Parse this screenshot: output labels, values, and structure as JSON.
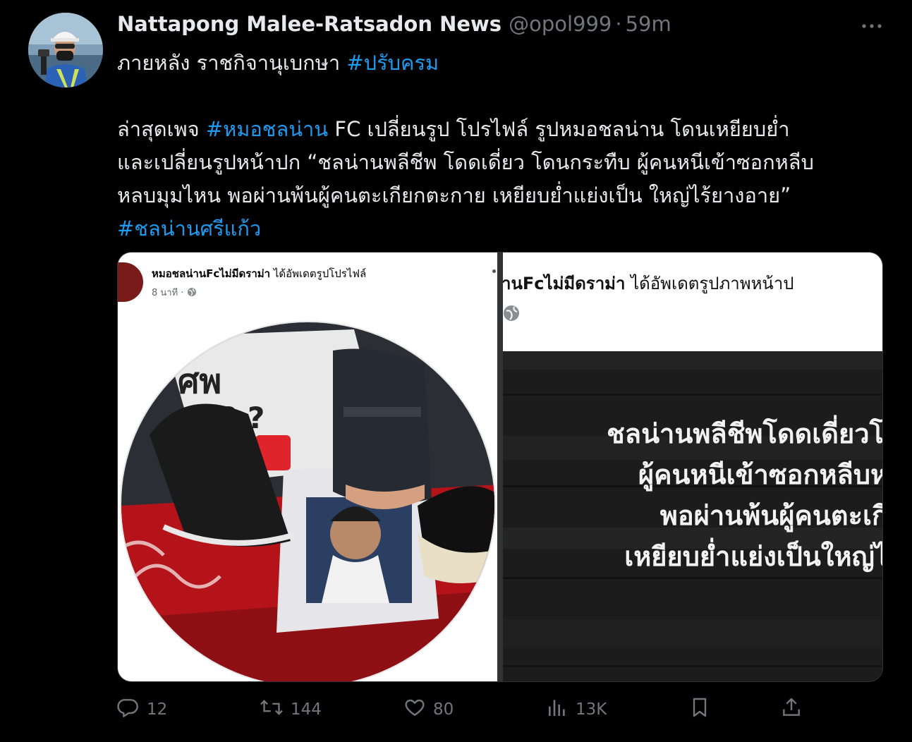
{
  "tweet": {
    "display_name": "Nattapong Malee-Ratsadon News",
    "handle": "@opol999",
    "separator": "·",
    "time": "59m",
    "more_icon": "ellipsis-icon",
    "body": {
      "line1_text": "ภายหลัง ราชกิจานุเบกษา ",
      "line1_tag": "#ปรับครม",
      "line2_text_a": "ล่าสุดเพจ ",
      "line2_tag": "#หมอชลน่าน",
      "line2_text_b": " FC เปลี่ยนรูป โปรไฟล์ รูปหมอชลน่าน โดนเหยียบย่ำ",
      "line3_text": "และเปลี่ยนรูปหน้าปก “ชลน่านพลีชีพ โดดเดี่ยว โดนกระทืบ ผู้คนหนีเข้าซอกหลีบ",
      "line4_text": "หลบมุมไหน พอผ่านพ้นผู้คนตะเกียกตะกาย เหยียบย่ำแย่งเป็น ใหญ่ไร้ยางอาย”",
      "line5_tag": "#ชลน่านศรีแก้ว"
    }
  },
  "media": {
    "left": {
      "page_name": "หมอชลน่านFcไม่มีดราม่า",
      "action_text": " ได้อัพเดตรูปโปรไฟล์",
      "time_text": "8 นาที · ",
      "globe_icon": "globe-icon"
    },
    "right": {
      "title_name": "านFcไม่มีดราม่า",
      "title_action": " ได้อัพเดตรูปภาพหน้าป",
      "lines": [
        "ชลน่านพลีชีพโดดเดี่ยวโ",
        "ผู้คนหนีเข้าซอกหลีบห",
        "พอผ่านพ้นผู้คนตะเกี",
        "เหยียบย่ำแย่งเป็นใหญ่ไ"
      ]
    }
  },
  "actions": {
    "reply": {
      "icon": "reply-icon",
      "count": "12"
    },
    "retweet": {
      "icon": "retweet-icon",
      "count": "144"
    },
    "like": {
      "icon": "heart-icon",
      "count": "80"
    },
    "views": {
      "icon": "views-icon",
      "count": "13K"
    },
    "bookmark": {
      "icon": "bookmark-icon"
    },
    "share": {
      "icon": "share-icon"
    }
  },
  "colors": {
    "background": "#000000",
    "text": "#e7e9ea",
    "muted": "#71767b",
    "link": "#1d9bf0"
  }
}
